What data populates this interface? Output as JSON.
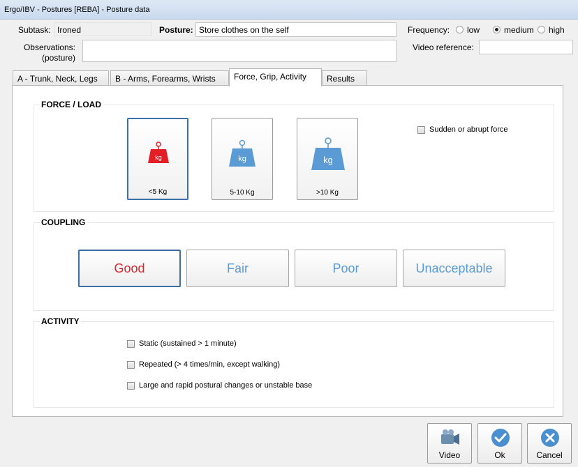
{
  "window": {
    "title": "Ergo/IBV - Postures [REBA] - Posture data"
  },
  "header": {
    "subtask_label": "Subtask:",
    "subtask_value": "Ironed",
    "posture_label": "Posture:",
    "posture_value": "Store clothes on the self",
    "frequency_label": "Frequency:",
    "frequency_options": [
      {
        "label": "low",
        "selected": false
      },
      {
        "label": "medium",
        "selected": true
      },
      {
        "label": "high",
        "selected": false
      }
    ],
    "observations_label_1": "Observations:",
    "observations_label_2": "(posture)",
    "observations_value": "",
    "video_reference_label": "Video reference:",
    "video_reference_value": ""
  },
  "tabs": [
    {
      "label": "A - Trunk, Neck, Legs",
      "active": false
    },
    {
      "label": "B - Arms, Forearms, Wrists",
      "active": false
    },
    {
      "label": "Force, Grip, Activity",
      "active": true
    },
    {
      "label": "Results",
      "active": false
    }
  ],
  "force": {
    "title": "FORCE / LOAD",
    "options": [
      {
        "label": "<5 Kg",
        "icon_text": "kg",
        "selected": true
      },
      {
        "label": "5-10 Kg",
        "icon_text": "kg",
        "selected": false
      },
      {
        "label": ">10 Kg",
        "icon_text": "kg",
        "selected": false
      }
    ],
    "sudden_label": "Sudden or abrupt force",
    "sudden_checked": false
  },
  "coupling": {
    "title": "COUPLING",
    "options": [
      {
        "label": "Good",
        "selected": true
      },
      {
        "label": "Fair",
        "selected": false
      },
      {
        "label": "Poor",
        "selected": false
      },
      {
        "label": "Unacceptable",
        "selected": false
      }
    ]
  },
  "activity": {
    "title": "ACTIVITY",
    "items": [
      {
        "label": "Static (sustained > 1 minute)",
        "checked": false
      },
      {
        "label": "Repeated (> 4 times/min, except walking)",
        "checked": false
      },
      {
        "label": "Large and rapid postural changes or unstable base",
        "checked": false
      }
    ]
  },
  "footer": {
    "video_label": "Video",
    "ok_label": "Ok",
    "cancel_label": "Cancel"
  },
  "colors": {
    "selected_weight": "#e31e24",
    "weight": "#5b9bd5",
    "good_text": "#d9262b",
    "coupling_text": "#5b9bd5"
  }
}
